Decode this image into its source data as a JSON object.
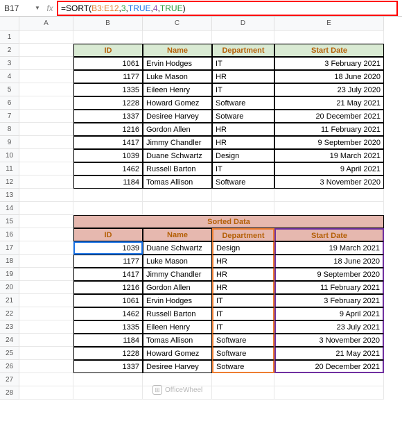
{
  "cellRef": "B17",
  "formula": {
    "prefix": "=SORT(",
    "range": "B3:E12",
    "args": [
      "3",
      "TRUE",
      "4",
      "TRUE"
    ],
    "suffix": ")"
  },
  "columns": [
    "",
    "A",
    "B",
    "C",
    "D",
    "E"
  ],
  "rowNums": [
    1,
    2,
    3,
    4,
    5,
    6,
    7,
    8,
    9,
    10,
    11,
    12,
    13,
    14,
    15,
    16,
    17,
    18,
    19,
    20,
    21,
    22,
    23,
    24,
    25,
    26,
    27,
    28
  ],
  "table1": {
    "headers": [
      "ID",
      "Name",
      "Department",
      "Start Date"
    ],
    "rows": [
      [
        "1061",
        "Ervin Hodges",
        "IT",
        "3 February 2021"
      ],
      [
        "1177",
        "Luke Mason",
        "HR",
        "18 June 2020"
      ],
      [
        "1335",
        "Eileen Henry",
        "IT",
        "23 July 2020"
      ],
      [
        "1228",
        "Howard Gomez",
        "Software",
        "21 May 2021"
      ],
      [
        "1337",
        "Desiree Harvey",
        "Sotware",
        "20 December 2021"
      ],
      [
        "1216",
        "Gordon Allen",
        "HR",
        "11 February 2021"
      ],
      [
        "1417",
        "Jimmy Chandler",
        "HR",
        "9 September 2020"
      ],
      [
        "1039",
        "Duane Schwartz",
        "Design",
        "19 March 2021"
      ],
      [
        "1462",
        "Russell Barton",
        "IT",
        "9 April 2021"
      ],
      [
        "1184",
        "Tomas Allison",
        "Software",
        "3 November 2020"
      ]
    ]
  },
  "table2": {
    "title": "Sorted Data",
    "headers": [
      "ID",
      "Name",
      "Department",
      "Start Date"
    ],
    "rows": [
      [
        "1039",
        "Duane Schwartz",
        "Design",
        "19 March 2021"
      ],
      [
        "1177",
        "Luke Mason",
        "HR",
        "18 June 2020"
      ],
      [
        "1417",
        "Jimmy Chandler",
        "HR",
        "9 September 2020"
      ],
      [
        "1216",
        "Gordon Allen",
        "HR",
        "11 February 2021"
      ],
      [
        "1061",
        "Ervin Hodges",
        "IT",
        "3 February 2021"
      ],
      [
        "1462",
        "Russell Barton",
        "IT",
        "9 April 2021"
      ],
      [
        "1335",
        "Eileen Henry",
        "IT",
        "23 July 2021"
      ],
      [
        "1184",
        "Tomas Allison",
        "Software",
        "3 November 2020"
      ],
      [
        "1228",
        "Howard Gomez",
        "Software",
        "21 May 2021"
      ],
      [
        "1337",
        "Desiree Harvey",
        "Sotware",
        "20 December 2021"
      ]
    ]
  },
  "watermark": "OfficeWheel"
}
